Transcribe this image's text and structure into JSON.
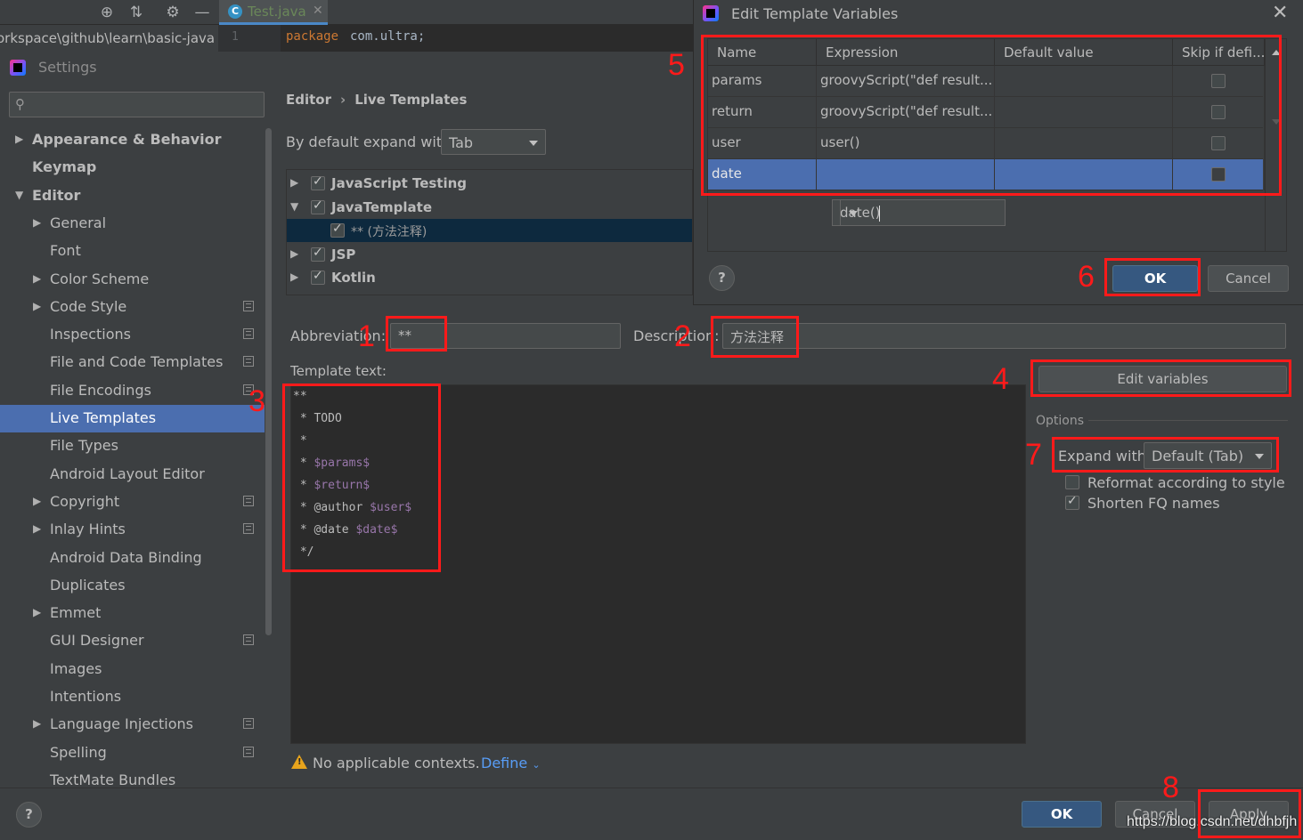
{
  "ide": {
    "file_tab": "Test.java",
    "file_tab_icon": "C",
    "path_fragment": "orkspace\\github\\learn\\basic-java",
    "line_number": "1",
    "code_keyword": "package",
    "code_rest": "com.ultra;"
  },
  "settings": {
    "title": "Settings",
    "search_placeholder": "",
    "tree": [
      {
        "label": "Appearance & Behavior",
        "bold": true,
        "arrow": "right"
      },
      {
        "label": "Keymap",
        "bold": true
      },
      {
        "label": "Editor",
        "bold": true,
        "arrow": "down"
      },
      {
        "label": "General",
        "arrow": "right"
      },
      {
        "label": "Font"
      },
      {
        "label": "Color Scheme",
        "arrow": "right"
      },
      {
        "label": "Code Style",
        "arrow": "right",
        "cfg": true
      },
      {
        "label": "Inspections",
        "cfg": true
      },
      {
        "label": "File and Code Templates",
        "cfg": true
      },
      {
        "label": "File Encodings",
        "cfg": true
      },
      {
        "label": "Live Templates",
        "selected": true
      },
      {
        "label": "File Types"
      },
      {
        "label": "Android Layout Editor"
      },
      {
        "label": "Copyright",
        "arrow": "right",
        "cfg": true
      },
      {
        "label": "Inlay Hints",
        "arrow": "right",
        "cfg": true
      },
      {
        "label": "Android Data Binding"
      },
      {
        "label": "Duplicates"
      },
      {
        "label": "Emmet",
        "arrow": "right"
      },
      {
        "label": "GUI Designer",
        "cfg": true
      },
      {
        "label": "Images"
      },
      {
        "label": "Intentions"
      },
      {
        "label": "Language Injections",
        "arrow": "right",
        "cfg": true
      },
      {
        "label": "Spelling",
        "cfg": true
      },
      {
        "label": "TextMate Bundles"
      }
    ]
  },
  "content": {
    "breadcrumb": [
      "Editor",
      "Live Templates"
    ],
    "breadcrumb_sep": "›",
    "expand_label": "By default expand with",
    "expand_value": "Tab",
    "template_groups": [
      {
        "label": "JavaScript Testing",
        "arrow": "right",
        "checked": true
      },
      {
        "label": "JavaTemplate",
        "arrow": "down",
        "checked": true
      },
      {
        "label": "** (方法注释)",
        "child": true,
        "checked": true,
        "selected": true
      },
      {
        "label": "JSP",
        "arrow": "right",
        "checked": true
      },
      {
        "label": "Kotlin",
        "arrow": "right",
        "checked": true
      }
    ],
    "abbreviation_label": "Abbreviation:",
    "abbreviation_value": "**",
    "description_label": "Description:",
    "description_value": "方法注释",
    "template_text_label": "Template text:",
    "template_lines": [
      [
        {
          "t": "**"
        }
      ],
      [
        {
          "t": " * TODO"
        }
      ],
      [
        {
          "t": " *"
        }
      ],
      [
        {
          "t": " * "
        },
        {
          "t": "$params$",
          "v": true
        }
      ],
      [
        {
          "t": " * "
        },
        {
          "t": "$return$",
          "v": true
        }
      ],
      [
        {
          "t": " * @author "
        },
        {
          "t": "$user$",
          "v": true
        }
      ],
      [
        {
          "t": " * @date "
        },
        {
          "t": "$date$",
          "v": true
        }
      ],
      [
        {
          "t": " */"
        }
      ]
    ],
    "edit_variables": "Edit variables",
    "options_label": "Options",
    "expand_with_label": "Expand with",
    "expand_with_value": "Default (Tab)",
    "reformat_label": "Reformat according to style",
    "reformat_checked": false,
    "shorten_label": "Shorten FQ names",
    "shorten_checked": true,
    "warning_text": "No applicable contexts.",
    "define_link": "Define"
  },
  "bottom": {
    "help": "?",
    "ok": "OK",
    "cancel": "Cancel",
    "apply": "Apply",
    "watermark": "https://blog.csdn.net/dhbfjh"
  },
  "dialog": {
    "title": "Edit Template Variables",
    "columns": [
      "Name",
      "Expression",
      "Default value",
      "Skip if defi..."
    ],
    "rows": [
      {
        "name": "params",
        "expression": "groovyScript(\"def result...",
        "default": "",
        "skip": false
      },
      {
        "name": "return",
        "expression": "groovyScript(\"def result...",
        "default": "",
        "skip": false
      },
      {
        "name": "user",
        "expression": "user()",
        "default": "",
        "skip": false
      },
      {
        "name": "date",
        "expression": "date()",
        "default": "",
        "skip": false,
        "selected": true
      }
    ],
    "help": "?",
    "ok": "OK",
    "cancel": "Cancel"
  },
  "annotations": [
    "1",
    "2",
    "3",
    "4",
    "5",
    "6",
    "7",
    "8"
  ],
  "colors": {
    "accent_selection": "#4b6eaf",
    "annotation_red": "#ff1a1a",
    "primary_button": "#365880",
    "link": "#589df6",
    "template_variable": "#9876aa"
  }
}
